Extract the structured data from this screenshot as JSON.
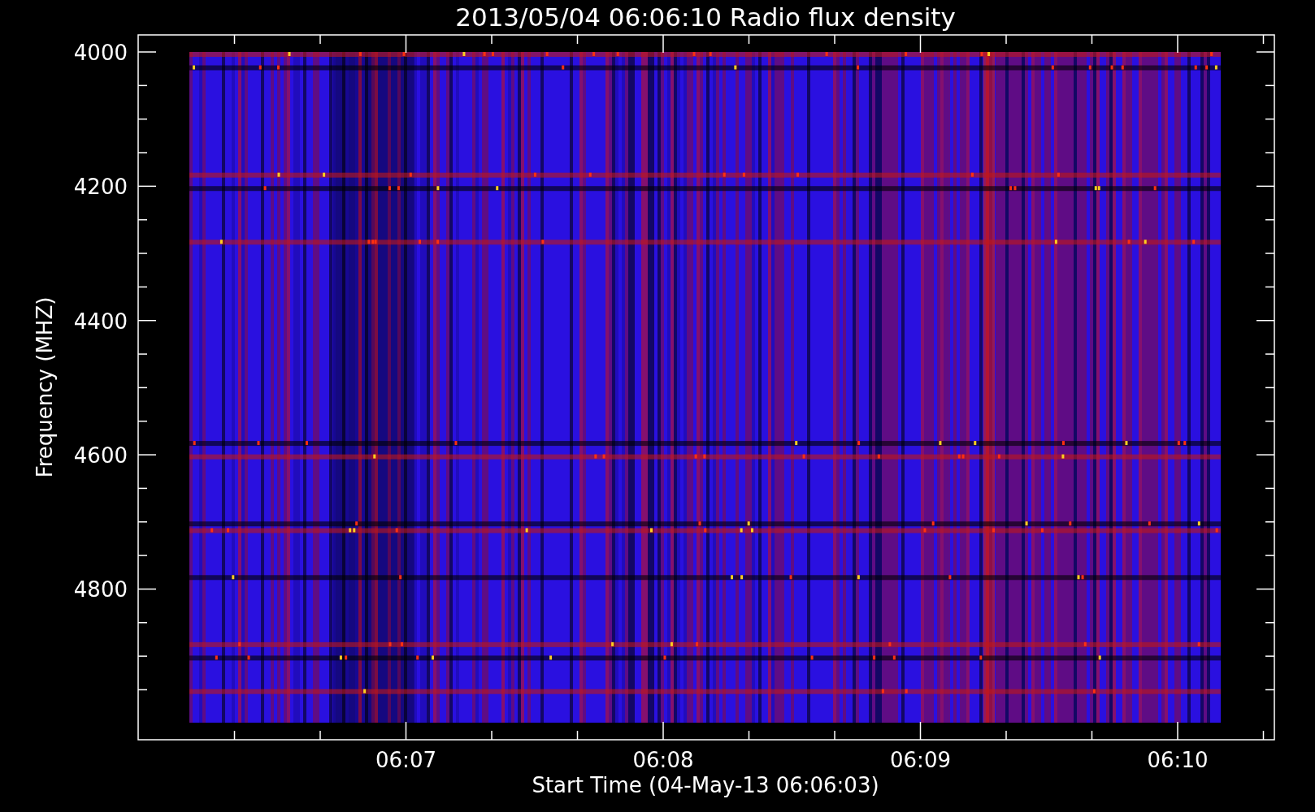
{
  "plot": {
    "title": "2013/05/04 06:06:10 Radio flux density",
    "ylabel": "Frequency (MHZ)",
    "xlabel": "Start Time (04-May-13 06:06:03)",
    "yticks": [
      "4000",
      "4200",
      "4400",
      "4600",
      "4800"
    ],
    "xticks": [
      "06:07",
      "06:08",
      "06:09",
      "06:10"
    ]
  }
}
